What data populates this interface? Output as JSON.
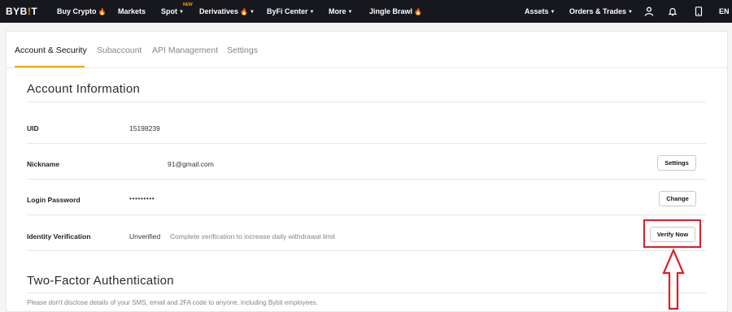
{
  "nav": {
    "logo_main": "BYB",
    "logo_mark": "!",
    "logo_end": "T",
    "items": [
      {
        "label": "Buy Crypto"
      },
      {
        "label": "Markets"
      },
      {
        "label": "Spot"
      },
      {
        "label": "Derivatives"
      },
      {
        "label": "ByFi Center"
      },
      {
        "label": "More"
      },
      {
        "label": "Jingle Brawl"
      }
    ],
    "new_badge": "NEW",
    "assets": "Assets",
    "orders": "Orders & Trades",
    "lang": "EN",
    "accent_color": "#f7a600"
  },
  "tabs": [
    {
      "label": "Account & Security",
      "active": true
    },
    {
      "label": "Subaccount"
    },
    {
      "label": "API Management"
    },
    {
      "label": "Settings"
    }
  ],
  "account_info": {
    "title": "Account Information",
    "rows": {
      "uid": {
        "label": "UID",
        "value": "15198239"
      },
      "nickname": {
        "label": "Nickname",
        "value": "91@gmail.com",
        "button": "Settings"
      },
      "password": {
        "label": "Login Password",
        "value": "•••••••••",
        "button": "Change"
      },
      "identity": {
        "label": "Identity Verification",
        "status": "Unverified",
        "hint": "Complete verification to increase daily withdrawal limit",
        "button": "Verify Now"
      }
    }
  },
  "two_factor": {
    "title": "Two-Factor Authentication",
    "note": "Please don't disclose details of your SMS, email and 2FA code to anyone, including Bybit employees."
  },
  "annotation": {
    "color": "#e01c24"
  }
}
